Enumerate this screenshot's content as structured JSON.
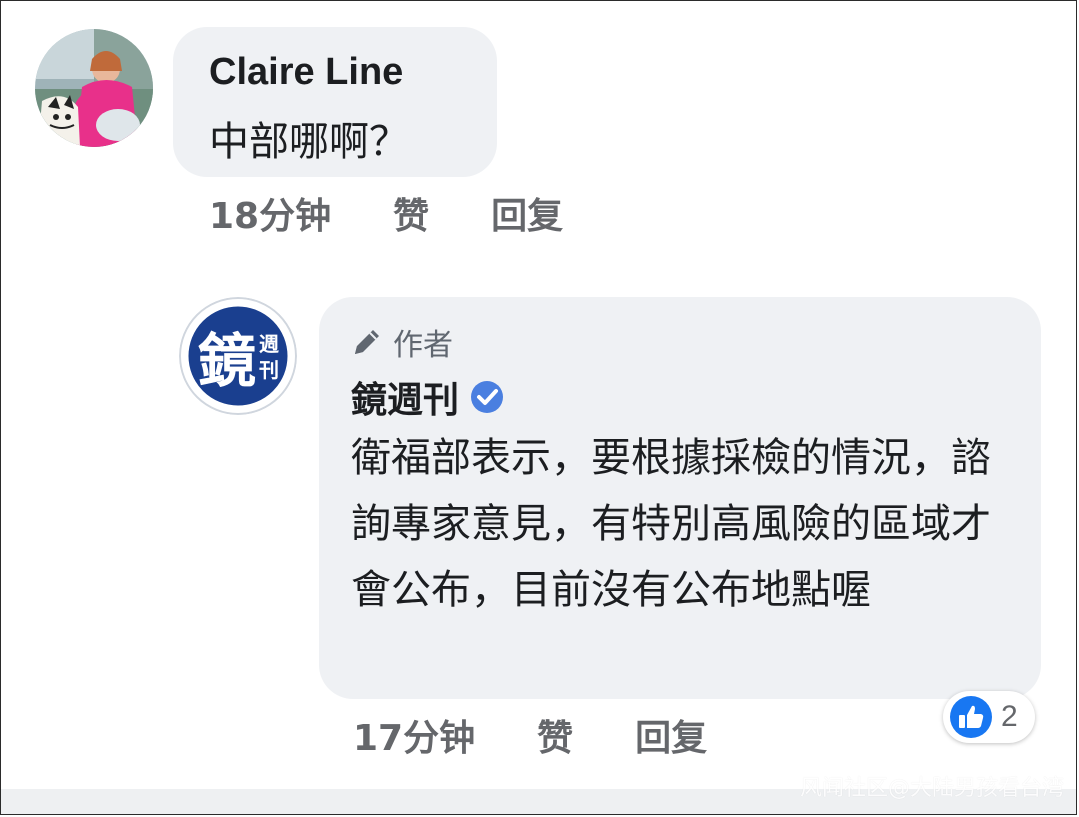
{
  "comments": [
    {
      "author": "Claire Line",
      "text": "中部哪啊？",
      "time": "18分钟",
      "like_label": "赞",
      "reply_label": "回复"
    },
    {
      "badge_icon": "pencil-icon",
      "badge_label": "作者",
      "author": "鏡週刊",
      "verified": true,
      "text": "衛福部表示，要根據採檢的情況，諮詢專家意見，有特別高風險的區域才會公布，目前沒有公布地點喔",
      "time": "17分钟",
      "like_label": "赞",
      "reply_label": "回复",
      "reaction_icon": "thumbs-up-icon",
      "reaction_count": "2"
    }
  ],
  "avatar2_logo": {
    "big_char": "鏡",
    "small_chars": "週刊"
  },
  "watermark": "风闻社区@大陆男孩看台湾",
  "colors": {
    "bubble": "#eff1f4",
    "meta": "#65676b",
    "accent": "#1877f2"
  }
}
